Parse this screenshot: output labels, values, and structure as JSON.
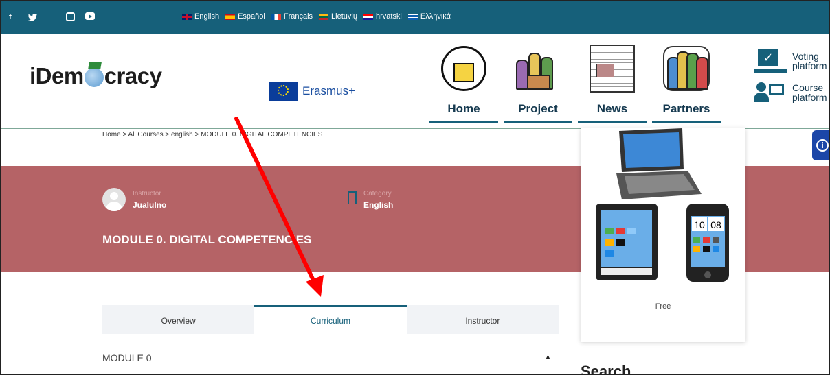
{
  "social": [
    "f",
    "twitter",
    "instagram",
    "youtube"
  ],
  "languages": [
    {
      "label": "English",
      "flag": "uk-flag"
    },
    {
      "label": "Español",
      "flag": "spain-flag"
    },
    {
      "label": "Français",
      "flag": "france-flag"
    },
    {
      "label": "Lietuvių",
      "flag": "lithuania-flag"
    },
    {
      "label": "hrvatski",
      "flag": "croatia-flag"
    },
    {
      "label": "Ελληνικά",
      "flag": "greece-flag"
    }
  ],
  "header": {
    "logo_pre": "iDem",
    "logo_post": "cracy",
    "erasmus": "Erasmus+",
    "nav": [
      "Home",
      "Project",
      "News",
      "Partners"
    ],
    "platforms": [
      {
        "line1": "Voting",
        "line2": "platform"
      },
      {
        "line1": "Course",
        "line2": "platform"
      }
    ]
  },
  "breadcrumb": "Home > All Courses > english > MODULE 0. DIGITAL COMPETENCIES",
  "course": {
    "instructor_label": "Instructor",
    "instructor_name": "Jualulno",
    "category_label": "Category",
    "category_value": "English",
    "title": "MODULE 0. DIGITAL COMPETENCIES"
  },
  "card": {
    "price": "Free"
  },
  "tabs": [
    "Overview",
    "Curriculum",
    "Instructor"
  ],
  "active_tab": "Curriculum",
  "curriculum": {
    "module": "MODULE 0",
    "caret": "▲"
  },
  "sidebar": {
    "search_title": "Search"
  },
  "colors": {
    "brand": "#16607a",
    "hero": "#b56366",
    "arrow": "#ff0000"
  }
}
